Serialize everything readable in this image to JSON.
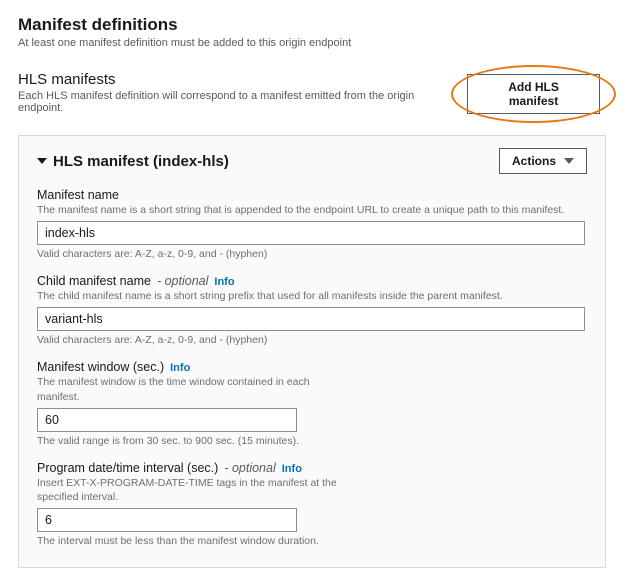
{
  "header": {
    "title": "Manifest definitions",
    "subtitle": "At least one manifest definition must be added to this origin endpoint"
  },
  "hls_section": {
    "title": "HLS manifests",
    "subtitle": "Each HLS manifest definition will correspond to a manifest emitted from the origin endpoint.",
    "add_button": "Add HLS manifest"
  },
  "panel": {
    "title": "HLS manifest (index-hls)",
    "actions_label": "Actions",
    "fields": {
      "manifest_name": {
        "label": "Manifest name",
        "desc": "The manifest name is a short string that is appended to the endpoint URL to create a unique path to this manifest.",
        "value": "index-hls",
        "hint": "Valid characters are: A-Z, a-z, 0-9, and - (hyphen)"
      },
      "child_manifest": {
        "label": "Child manifest name",
        "optional": "- optional",
        "info": "Info",
        "desc": "The child manifest name is a short string prefix that used for all manifests inside the parent manifest.",
        "value": "variant-hls",
        "hint": "Valid characters are: A-Z, a-z, 0-9, and - (hyphen)"
      },
      "window": {
        "label": "Manifest window (sec.)",
        "info": "Info",
        "desc": "The manifest window is the time window contained in each manifest.",
        "value": "60",
        "hint": "The valid range is from 30 sec. to 900 sec. (15 minutes)."
      },
      "pdt": {
        "label": "Program date/time interval (sec.)",
        "optional": "- optional",
        "info": "Info",
        "desc": "Insert EXT-X-PROGRAM-DATE-TIME tags in the manifest at the specified interval.",
        "value": "6",
        "hint": "The interval must be less than the manifest window duration."
      }
    }
  }
}
